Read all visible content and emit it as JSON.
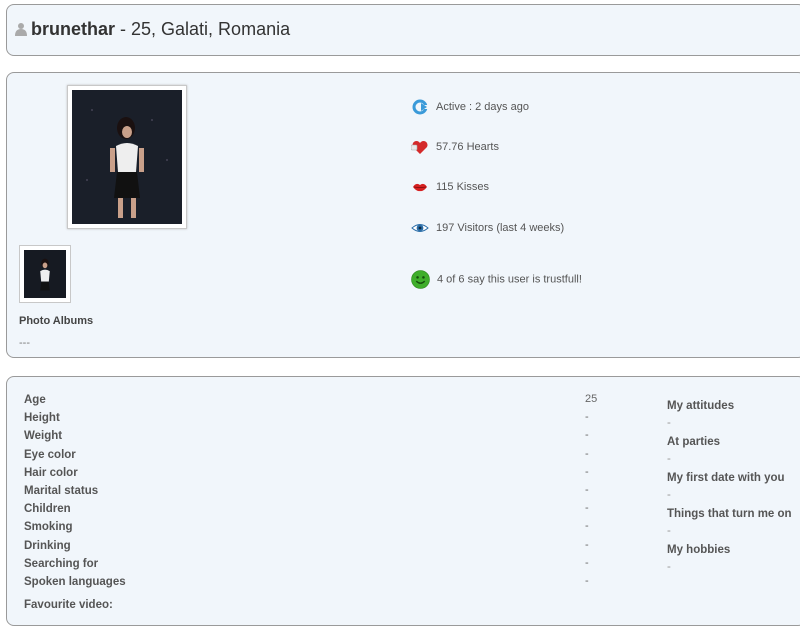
{
  "header": {
    "username": "brunethar",
    "details": " - 25, Galati, Romania"
  },
  "profile": {
    "photo_albums_label": "Photo Albums",
    "photo_albums_value": "---",
    "stats": [
      {
        "icon": "active-refresh-icon",
        "text": "Active : 2 days ago"
      },
      {
        "icon": "hearts-icon",
        "text": "57.76 Hearts"
      },
      {
        "icon": "kisses-lips-icon",
        "text": "115 Kisses"
      },
      {
        "icon": "visitors-eye-icon",
        "text": "197 Visitors (last 4 weeks)"
      },
      {
        "icon": "trust-smiley-icon",
        "text": "4 of 6 say this user is trustfull!"
      }
    ]
  },
  "details": {
    "fields": [
      {
        "label": "Age",
        "value": "25"
      },
      {
        "label": "Height",
        "value": "-"
      },
      {
        "label": "Weight",
        "value": "-"
      },
      {
        "label": "Eye color",
        "value": "-"
      },
      {
        "label": "Hair color",
        "value": "-"
      },
      {
        "label": "Marital status",
        "value": "-"
      },
      {
        "label": "Children",
        "value": "-"
      },
      {
        "label": "Smoking",
        "value": "-"
      },
      {
        "label": "Drinking",
        "value": "-"
      },
      {
        "label": "Searching for",
        "value": "-"
      },
      {
        "label": "Spoken languages",
        "value": "-"
      }
    ],
    "favourite_video_label": "Favourite video:",
    "questions": [
      {
        "label": "My attitudes",
        "value": "-"
      },
      {
        "label": "At parties",
        "value": "-"
      },
      {
        "label": "My first date with you",
        "value": "-"
      },
      {
        "label": "Things that turn me on",
        "value": "-"
      },
      {
        "label": "My hobbies",
        "value": "-"
      }
    ]
  }
}
